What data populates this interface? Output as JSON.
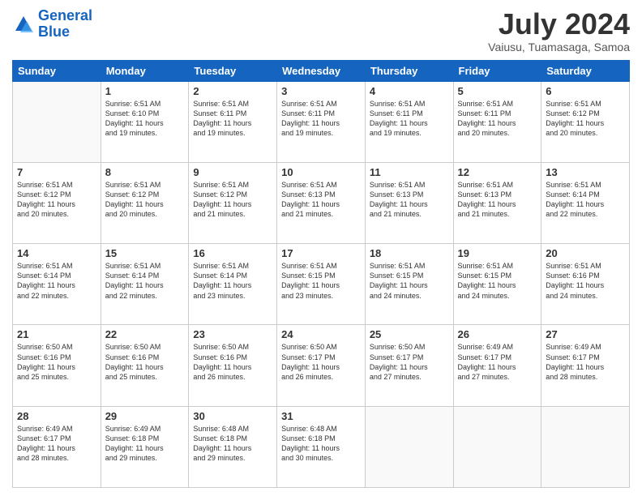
{
  "logo": {
    "text_general": "General",
    "text_blue": "Blue"
  },
  "header": {
    "month": "July 2024",
    "location": "Vaiusu, Tuamasaga, Samoa"
  },
  "weekdays": [
    "Sunday",
    "Monday",
    "Tuesday",
    "Wednesday",
    "Thursday",
    "Friday",
    "Saturday"
  ],
  "weeks": [
    [
      {
        "day": "",
        "info": ""
      },
      {
        "day": "1",
        "info": "Sunrise: 6:51 AM\nSunset: 6:10 PM\nDaylight: 11 hours\nand 19 minutes."
      },
      {
        "day": "2",
        "info": "Sunrise: 6:51 AM\nSunset: 6:11 PM\nDaylight: 11 hours\nand 19 minutes."
      },
      {
        "day": "3",
        "info": "Sunrise: 6:51 AM\nSunset: 6:11 PM\nDaylight: 11 hours\nand 19 minutes."
      },
      {
        "day": "4",
        "info": "Sunrise: 6:51 AM\nSunset: 6:11 PM\nDaylight: 11 hours\nand 19 minutes."
      },
      {
        "day": "5",
        "info": "Sunrise: 6:51 AM\nSunset: 6:11 PM\nDaylight: 11 hours\nand 20 minutes."
      },
      {
        "day": "6",
        "info": "Sunrise: 6:51 AM\nSunset: 6:12 PM\nDaylight: 11 hours\nand 20 minutes."
      }
    ],
    [
      {
        "day": "7",
        "info": "Sunrise: 6:51 AM\nSunset: 6:12 PM\nDaylight: 11 hours\nand 20 minutes."
      },
      {
        "day": "8",
        "info": "Sunrise: 6:51 AM\nSunset: 6:12 PM\nDaylight: 11 hours\nand 20 minutes."
      },
      {
        "day": "9",
        "info": "Sunrise: 6:51 AM\nSunset: 6:12 PM\nDaylight: 11 hours\nand 21 minutes."
      },
      {
        "day": "10",
        "info": "Sunrise: 6:51 AM\nSunset: 6:13 PM\nDaylight: 11 hours\nand 21 minutes."
      },
      {
        "day": "11",
        "info": "Sunrise: 6:51 AM\nSunset: 6:13 PM\nDaylight: 11 hours\nand 21 minutes."
      },
      {
        "day": "12",
        "info": "Sunrise: 6:51 AM\nSunset: 6:13 PM\nDaylight: 11 hours\nand 21 minutes."
      },
      {
        "day": "13",
        "info": "Sunrise: 6:51 AM\nSunset: 6:14 PM\nDaylight: 11 hours\nand 22 minutes."
      }
    ],
    [
      {
        "day": "14",
        "info": "Sunrise: 6:51 AM\nSunset: 6:14 PM\nDaylight: 11 hours\nand 22 minutes."
      },
      {
        "day": "15",
        "info": "Sunrise: 6:51 AM\nSunset: 6:14 PM\nDaylight: 11 hours\nand 22 minutes."
      },
      {
        "day": "16",
        "info": "Sunrise: 6:51 AM\nSunset: 6:14 PM\nDaylight: 11 hours\nand 23 minutes."
      },
      {
        "day": "17",
        "info": "Sunrise: 6:51 AM\nSunset: 6:15 PM\nDaylight: 11 hours\nand 23 minutes."
      },
      {
        "day": "18",
        "info": "Sunrise: 6:51 AM\nSunset: 6:15 PM\nDaylight: 11 hours\nand 24 minutes."
      },
      {
        "day": "19",
        "info": "Sunrise: 6:51 AM\nSunset: 6:15 PM\nDaylight: 11 hours\nand 24 minutes."
      },
      {
        "day": "20",
        "info": "Sunrise: 6:51 AM\nSunset: 6:16 PM\nDaylight: 11 hours\nand 24 minutes."
      }
    ],
    [
      {
        "day": "21",
        "info": "Sunrise: 6:50 AM\nSunset: 6:16 PM\nDaylight: 11 hours\nand 25 minutes."
      },
      {
        "day": "22",
        "info": "Sunrise: 6:50 AM\nSunset: 6:16 PM\nDaylight: 11 hours\nand 25 minutes."
      },
      {
        "day": "23",
        "info": "Sunrise: 6:50 AM\nSunset: 6:16 PM\nDaylight: 11 hours\nand 26 minutes."
      },
      {
        "day": "24",
        "info": "Sunrise: 6:50 AM\nSunset: 6:17 PM\nDaylight: 11 hours\nand 26 minutes."
      },
      {
        "day": "25",
        "info": "Sunrise: 6:50 AM\nSunset: 6:17 PM\nDaylight: 11 hours\nand 27 minutes."
      },
      {
        "day": "26",
        "info": "Sunrise: 6:49 AM\nSunset: 6:17 PM\nDaylight: 11 hours\nand 27 minutes."
      },
      {
        "day": "27",
        "info": "Sunrise: 6:49 AM\nSunset: 6:17 PM\nDaylight: 11 hours\nand 28 minutes."
      }
    ],
    [
      {
        "day": "28",
        "info": "Sunrise: 6:49 AM\nSunset: 6:17 PM\nDaylight: 11 hours\nand 28 minutes."
      },
      {
        "day": "29",
        "info": "Sunrise: 6:49 AM\nSunset: 6:18 PM\nDaylight: 11 hours\nand 29 minutes."
      },
      {
        "day": "30",
        "info": "Sunrise: 6:48 AM\nSunset: 6:18 PM\nDaylight: 11 hours\nand 29 minutes."
      },
      {
        "day": "31",
        "info": "Sunrise: 6:48 AM\nSunset: 6:18 PM\nDaylight: 11 hours\nand 30 minutes."
      },
      {
        "day": "",
        "info": ""
      },
      {
        "day": "",
        "info": ""
      },
      {
        "day": "",
        "info": ""
      }
    ]
  ]
}
